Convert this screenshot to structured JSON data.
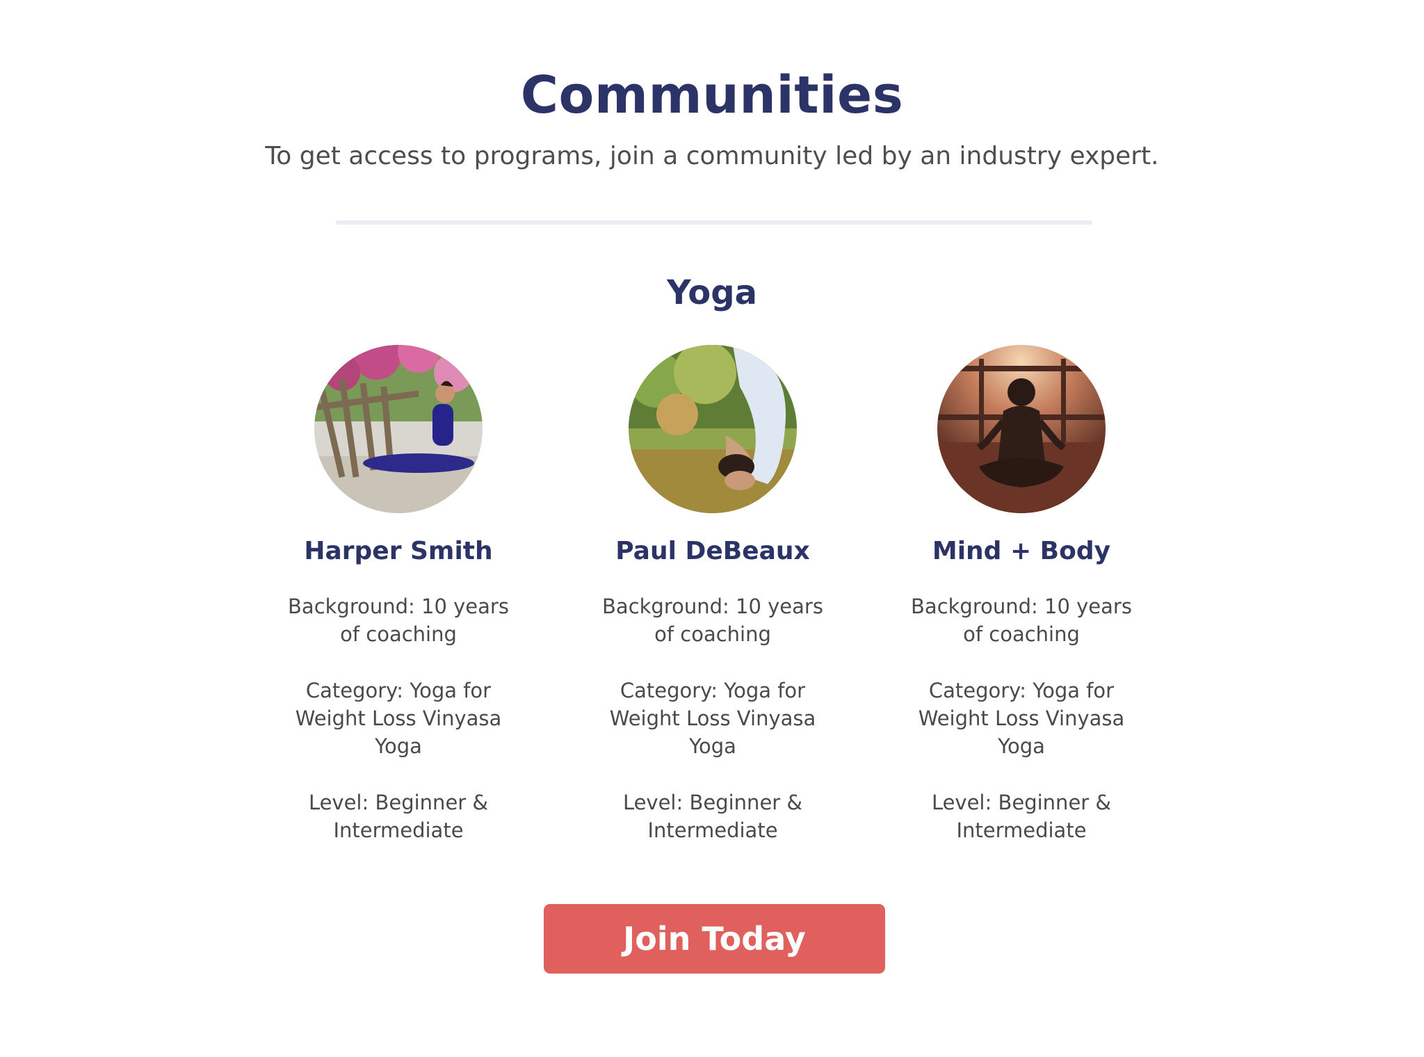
{
  "header": {
    "title": "Communities",
    "subtitle": "To get access to programs, join a community led by an industry expert."
  },
  "section": {
    "title": "Yoga"
  },
  "communities": [
    {
      "name": "Harper Smith",
      "background": "Background: 10 years of coaching",
      "category": "Category: Yoga for Weight Loss Vinyasa Yoga",
      "level": "Level: Beginner & Intermediate",
      "photo": "yoga-pose-outdoor-photo"
    },
    {
      "name": "Paul DeBeaux",
      "background": "Background: 10 years of coaching",
      "category": "Category: Yoga for Weight Loss Vinyasa Yoga",
      "level": "Level: Beginner & Intermediate",
      "photo": "yoga-backbend-park-photo"
    },
    {
      "name": "Mind + Body",
      "background": "Background: 10 years of coaching",
      "category": "Category: Yoga for Weight Loss Vinyasa Yoga",
      "level": "Level: Beginner & Intermediate",
      "photo": "meditation-sunset-photo"
    }
  ],
  "cta": {
    "label": "Join Today"
  },
  "colors": {
    "heading": "#2c3467",
    "body_text": "#4a4a4a",
    "divider": "#eaecf1",
    "button": "#e0605e",
    "button_text": "#ffffff"
  }
}
